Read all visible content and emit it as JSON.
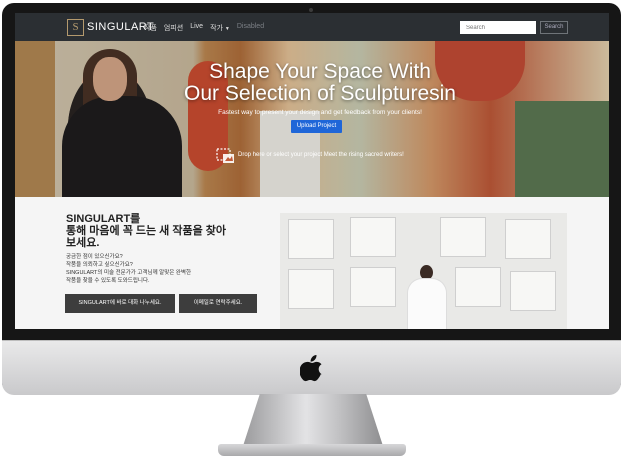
{
  "nav": {
    "brand": "SINGULART",
    "logo_letter": "S",
    "menu": [
      "작품",
      "엄피션",
      "Live",
      "작가"
    ],
    "disabled_label": "Disabled",
    "search_placeholder": "Search",
    "search_button": "Search"
  },
  "hero": {
    "title_line1": "Shape Your Space With",
    "title_line2": "Our Selection of Sculpturesin",
    "subtitle": "Fastest way to present your design and get feedback from your clients!",
    "upload_button": "Upload Project",
    "drop_text": "Drop here or select your project Meet the rising sacred writers!"
  },
  "intro": {
    "heading_line1": "SINGULART를",
    "heading_line2": "통해 마음에 꼭 드는 새 작품을 찾아",
    "heading_line3": "보세요.",
    "desc_line1": "궁금한 점이 있으신가요?",
    "desc_line2": "작품을 의뢰하고 싶으신가요?",
    "desc_line3": "SINGULART의 미술 전문가가 고객님께 알맞은 완벽한",
    "desc_line4": "작품을 찾을 수 있도록 도와드립니다.",
    "primary_button": "SINGULART에 바로 대화 나누세요.",
    "secondary_button": "이메일로 연락주세요."
  },
  "colors": {
    "nav_bg": "#2b2f33",
    "accent": "#1f66d8",
    "button_dark": "#3d3d3d",
    "logo_gold": "#b49a6e"
  }
}
